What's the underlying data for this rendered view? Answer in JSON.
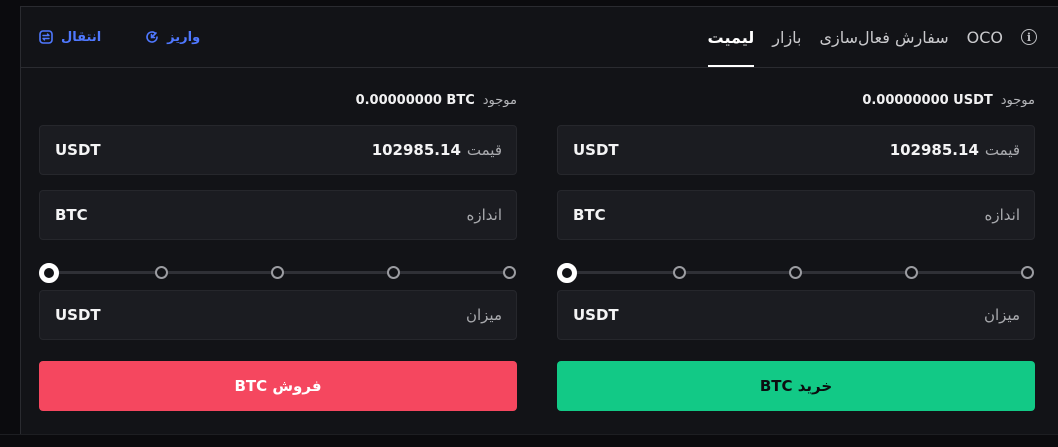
{
  "tabs": [
    "لیمیت",
    "بازار",
    "سفارش فعال‌سازی",
    "OCO"
  ],
  "header_actions": {
    "transfer": "انتقال",
    "deposit": "واریز"
  },
  "buy": {
    "available_label": "موجود",
    "available_value": "0.00000000 USDT",
    "price_label": "قیمت",
    "price_value": "102985.14",
    "price_unit": "USDT",
    "size_label": "اندازه",
    "size_unit": "BTC",
    "amount_label": "میزان",
    "amount_unit": "USDT",
    "slider_value": 0,
    "button_label": "خرید BTC"
  },
  "sell": {
    "available_label": "موجود",
    "available_value": "0.00000000 BTC",
    "price_label": "قیمت",
    "price_value": "102985.14",
    "price_unit": "USDT",
    "size_label": "اندازه",
    "size_unit": "BTC",
    "amount_label": "میزان",
    "amount_unit": "USDT",
    "slider_value": 0,
    "button_label": "فروش BTC"
  },
  "colors": {
    "buy": "#12c986",
    "sell": "#f5475f",
    "link": "#4f78ff"
  }
}
